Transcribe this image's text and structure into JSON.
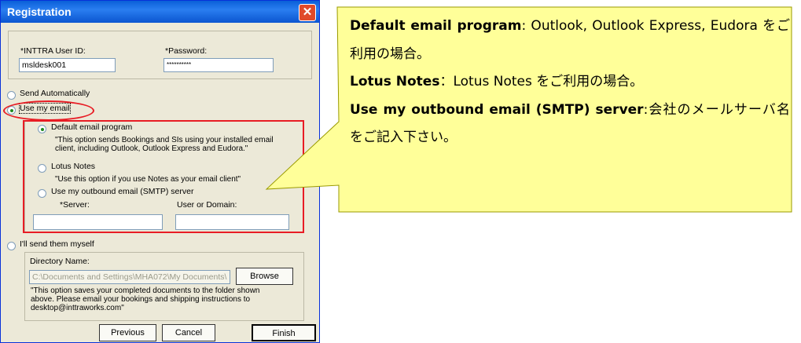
{
  "window": {
    "title": "Registration",
    "close_glyph": "✕"
  },
  "login": {
    "user_id_label": "*INTTRA User ID:",
    "user_id_value": "msldesk001",
    "password_label": "*Password:",
    "password_value": "**********"
  },
  "options": {
    "send_auto": "Send Automatically",
    "use_email": "Use my email",
    "default_program": "Default email program",
    "default_desc1": "\"This option sends Bookings and SIs using your installed email",
    "default_desc2": "client, including Outlook, Outlook Express and Eudora.\"",
    "lotus": "Lotus Notes",
    "lotus_desc": "\"Use this option if you use Notes as your email client\"",
    "smtp": "Use my outbound email (SMTP) server",
    "server_label": "*Server:",
    "domain_label": "User or Domain:",
    "send_myself": "I'll send them myself",
    "dir_label": "Directory Name:",
    "dir_value": "C:\\Documents and Settings\\MHA072\\My Documents\\",
    "browse": "Browse",
    "myself_desc1": "\"This option saves your completed documents to the folder shown",
    "myself_desc2": "above.  Please email your bookings and shipping instructions to",
    "myself_desc3": "desktop@inttraworks.com\""
  },
  "buttons": {
    "previous": "Previous",
    "cancel": "Cancel",
    "finish": "Finish"
  },
  "callout": {
    "l1_bold": "Default email program",
    "l1_rest": ": Outlook, Outlook Express, Eudora をご利用の場合。",
    "l2_bold": "Lotus Notes",
    "l2_rest": "：Lotus Notes をご利用の場合。",
    "l3_bold": "Use my outbound email (SMTP) server",
    "l3_rest": ":会社のメールサーバ名をご記入下さい。"
  },
  "colors": {
    "callout_fill": "#ffff99",
    "highlight_red": "#e81c24"
  }
}
